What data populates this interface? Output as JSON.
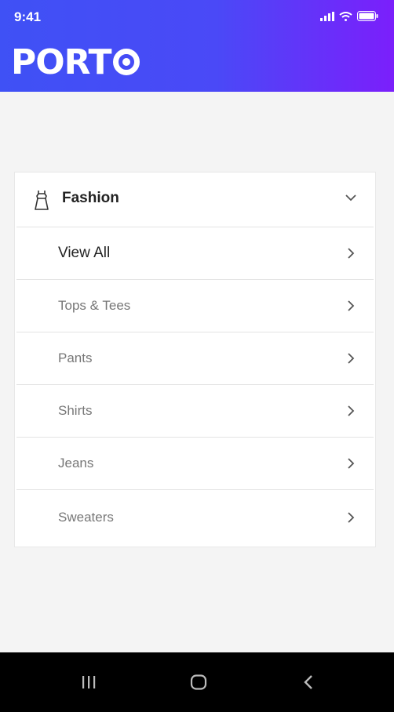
{
  "status_bar": {
    "time": "9:41"
  },
  "brand": {
    "logo_text": "PORT",
    "logo_mark": "O"
  },
  "menu": {
    "category": "Fashion",
    "items": [
      {
        "label": "View All"
      },
      {
        "label": "Tops & Tees"
      },
      {
        "label": "Pants"
      },
      {
        "label": "Shirts"
      },
      {
        "label": "Jeans"
      },
      {
        "label": "Sweaters"
      }
    ]
  },
  "icons": {
    "category": "dress-icon",
    "expand": "chevron-down-icon",
    "item": "chevron-right-icon",
    "nav": [
      "recent-apps-icon",
      "home-icon",
      "back-icon"
    ]
  },
  "colors": {
    "header_gradient_start": "#3f51f5",
    "header_gradient_end": "#7b1ffb",
    "background": "#f4f4f4"
  }
}
